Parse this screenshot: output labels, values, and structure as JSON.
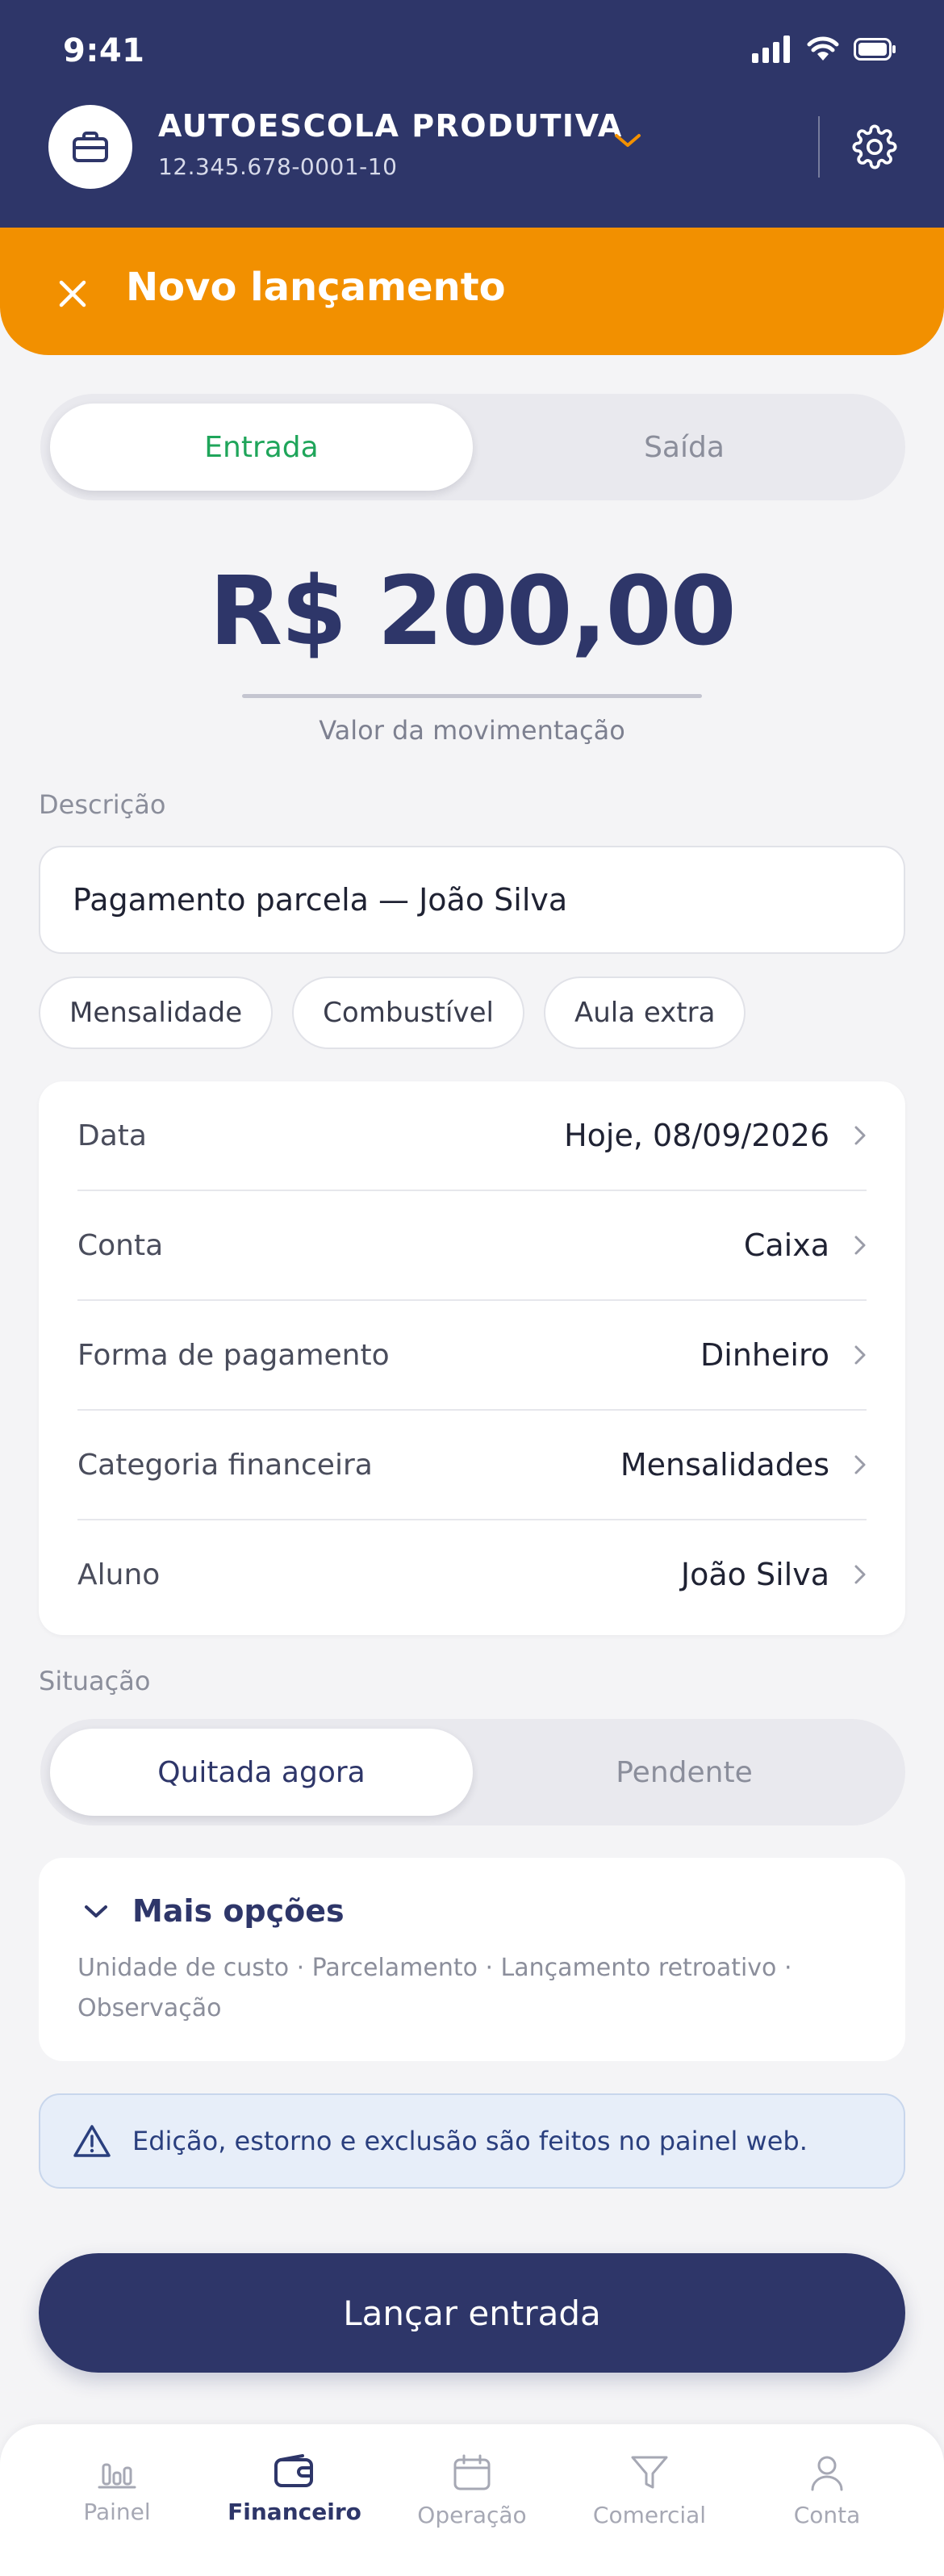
{
  "status_bar": {
    "time": "9:41"
  },
  "header": {
    "company_name": "AUTOESCOLA PRODUTIVA",
    "company_cnpj": "12.345.678-0001-10"
  },
  "title_bar": {
    "title": "Novo lançamento"
  },
  "type_toggle": {
    "options": [
      "Entrada",
      "Saída"
    ],
    "selected": "Entrada"
  },
  "amount": {
    "value": "R$ 200,00",
    "caption": "Valor da movimentação"
  },
  "description": {
    "label": "Descrição",
    "value": "Pagamento parcela — João Silva",
    "chips": [
      "Mensalidade",
      "Combustível",
      "Aula extra"
    ]
  },
  "details": [
    {
      "label": "Data",
      "value": "Hoje, 08/09/2026"
    },
    {
      "label": "Conta",
      "value": "Caixa"
    },
    {
      "label": "Forma de pagamento",
      "value": "Dinheiro"
    },
    {
      "label": "Categoria financeira",
      "value": "Mensalidades"
    },
    {
      "label": "Aluno",
      "value": "João Silva"
    }
  ],
  "situation": {
    "label": "Situação",
    "options": [
      "Quitada agora",
      "Pendente"
    ],
    "selected": "Quitada agora"
  },
  "more_options": {
    "title": "Mais opções",
    "subtitle": "Unidade de custo · Parcelamento · Lançamento retroativo · Observação"
  },
  "info_banner": {
    "text": "Edição, estorno e exclusão são feitos no painel web."
  },
  "primary_button": {
    "label": "Lançar entrada"
  },
  "tabs": [
    {
      "label": "Painel",
      "icon": "chart-bars-icon"
    },
    {
      "label": "Financeiro",
      "icon": "wallet-icon"
    },
    {
      "label": "Operação",
      "icon": "calendar-icon"
    },
    {
      "label": "Comercial",
      "icon": "funnel-icon"
    },
    {
      "label": "Conta",
      "icon": "user-icon"
    }
  ],
  "active_tab": "Financeiro",
  "colors": {
    "navy": "#2e3669",
    "orange": "#f29000",
    "green": "#1fa55a",
    "background": "#f4f4f6"
  }
}
